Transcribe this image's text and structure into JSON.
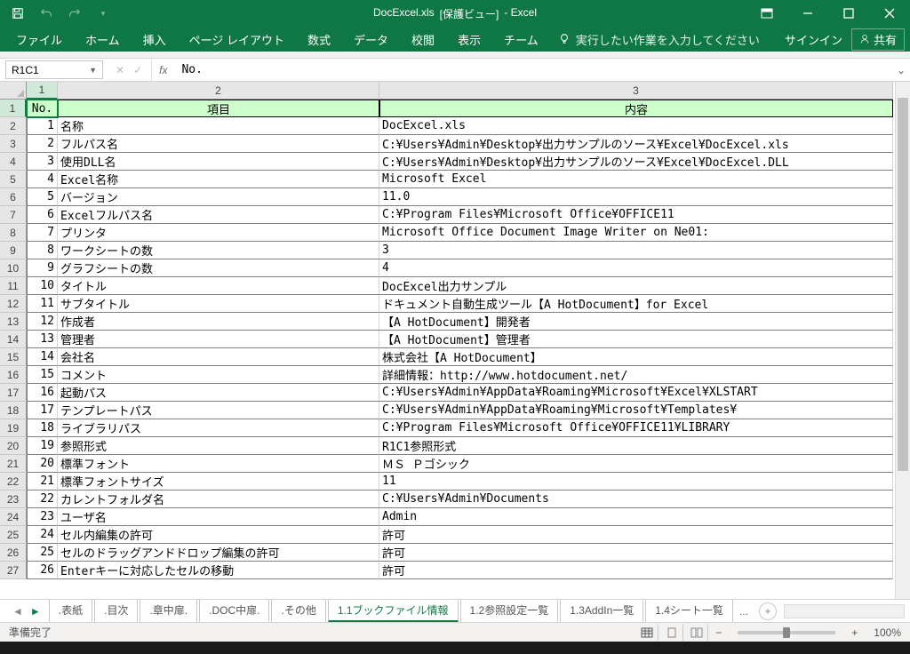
{
  "title": {
    "doc": "DocExcel.xls",
    "mode": "[保護ビュー]",
    "app": "- Excel"
  },
  "ribbon": {
    "tabs": [
      "ファイル",
      "ホーム",
      "挿入",
      "ページ レイアウト",
      "数式",
      "データ",
      "校閲",
      "表示",
      "チーム"
    ],
    "tellme": "実行したい作業を入力してください",
    "signin": "サインイン",
    "share": "共有"
  },
  "formula_bar": {
    "name_box": "R1C1",
    "fx": "fx",
    "value": "No."
  },
  "columns": [
    "1",
    "2",
    "3"
  ],
  "headers": {
    "c1": "No.",
    "c2": "項目",
    "c3": "内容"
  },
  "rows": [
    {
      "n": "1",
      "item": "名称",
      "val": "DocExcel.xls"
    },
    {
      "n": "2",
      "item": "フルパス名",
      "val": "C:\\Users\\Admin\\Desktop\\出力サンプルのソース\\Excel\\DocExcel.xls"
    },
    {
      "n": "3",
      "item": "使用DLL名",
      "val": "C:\\Users\\Admin\\Desktop\\出力サンプルのソース\\Excel\\DocExcel.DLL"
    },
    {
      "n": "4",
      "item": "Excel名称",
      "val": "Microsoft Excel"
    },
    {
      "n": "5",
      "item": "バージョン",
      "val": "11.0"
    },
    {
      "n": "6",
      "item": "Excelフルパス名",
      "val": "C:\\Program Files\\Microsoft Office\\OFFICE11"
    },
    {
      "n": "7",
      "item": "プリンタ",
      "val": "Microsoft Office Document Image Writer on Ne01:"
    },
    {
      "n": "8",
      "item": "ワークシートの数",
      "val": "3"
    },
    {
      "n": "9",
      "item": "グラフシートの数",
      "val": "4"
    },
    {
      "n": "10",
      "item": "タイトル",
      "val": "DocExcel出力サンプル"
    },
    {
      "n": "11",
      "item": "サブタイトル",
      "val": "ドキュメント自動生成ツール【A HotDocument】for Excel"
    },
    {
      "n": "12",
      "item": "作成者",
      "val": "【A HotDocument】開発者"
    },
    {
      "n": "13",
      "item": "管理者",
      "val": "【A HotDocument】管理者"
    },
    {
      "n": "14",
      "item": "会社名",
      "val": "株式会社【A HotDocument】"
    },
    {
      "n": "15",
      "item": "コメント",
      "val": "詳細情報：http://www.hotdocument.net/"
    },
    {
      "n": "16",
      "item": "起動パス",
      "val": "C:\\Users\\Admin\\AppData\\Roaming\\Microsoft\\Excel\\XLSTART"
    },
    {
      "n": "17",
      "item": "テンプレートパス",
      "val": "C:\\Users\\Admin\\AppData\\Roaming\\Microsoft\\Templates\\"
    },
    {
      "n": "18",
      "item": "ライブラリパス",
      "val": "C:\\Program Files\\Microsoft Office\\OFFICE11\\LIBRARY"
    },
    {
      "n": "19",
      "item": "参照形式",
      "val": "R1C1参照形式"
    },
    {
      "n": "20",
      "item": "標準フォント",
      "val": "ＭＳ Ｐゴシック"
    },
    {
      "n": "21",
      "item": "標準フォントサイズ",
      "val": "11"
    },
    {
      "n": "22",
      "item": "カレントフォルダ名",
      "val": "C:\\Users\\Admin\\Documents"
    },
    {
      "n": "23",
      "item": "ユーザ名",
      "val": "Admin"
    },
    {
      "n": "24",
      "item": "セル内編集の許可",
      "val": "許可"
    },
    {
      "n": "25",
      "item": "セルのドラッグアンドドロップ編集の許可",
      "val": "許可"
    },
    {
      "n": "26",
      "item": "Enterキーに対応したセルの移動",
      "val": "許可"
    }
  ],
  "sheets": {
    "list": [
      ".表紙",
      ".目次",
      ".章中扉.",
      ".DOC中扉.",
      ".その他",
      "1.1ブックファイル情報",
      "1.2参照設定一覧",
      "1.3AddIn一覧",
      "1.4シート一覧"
    ],
    "active": 5,
    "more": "..."
  },
  "status": {
    "ready": "準備完了",
    "zoom": "100%",
    "minus": "−",
    "plus": "+"
  }
}
